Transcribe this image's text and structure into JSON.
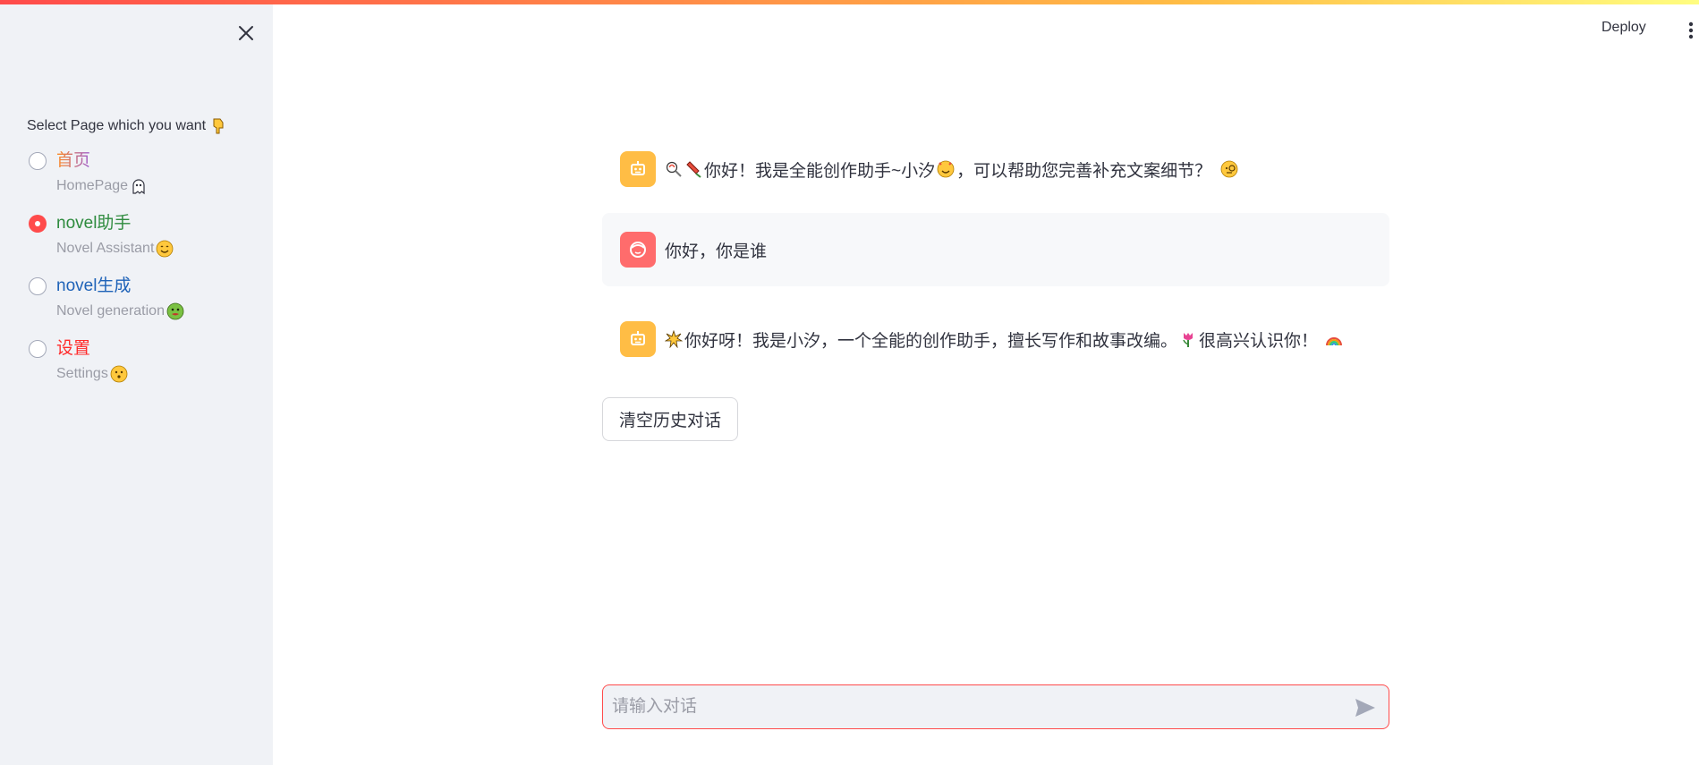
{
  "header": {
    "deploy_label": "Deploy",
    "menu_icon": "vertical-dots-icon"
  },
  "sidebar": {
    "close_icon": "close-icon",
    "prompt": "Select Page which you want",
    "prompt_icon": "pointing-down-hand-icon",
    "selected_index": 1,
    "options": [
      {
        "title": "首页",
        "subtitle": "HomePage",
        "icon": "ghost-icon",
        "title_color": "gradient-orange-purple"
      },
      {
        "title": "novel助手",
        "subtitle": "Novel Assistant",
        "icon": "smiling-face-icon",
        "title_color": "#2e8b3e"
      },
      {
        "title": "novel生成",
        "subtitle": "Novel generation",
        "icon": "nauseated-face-icon",
        "title_color": "#1f63b8"
      },
      {
        "title": "设置",
        "subtitle": "Settings",
        "icon": "neutral-face-icon",
        "title_color": "#ff2b2b"
      }
    ]
  },
  "chat": {
    "messages": [
      {
        "role": "assistant",
        "avatar_icon": "robot-icon",
        "text_a": "你好！我是全能创作助手~小汐",
        "text_b": "，可以帮助您完善补充文案细节？",
        "icons": [
          "lollipop-icon",
          "firecracker-icon",
          "smiling-hearts-icon",
          "monocle-face-icon"
        ]
      },
      {
        "role": "user",
        "avatar_icon": "face-icon",
        "text": "你好，你是谁"
      },
      {
        "role": "assistant",
        "avatar_icon": "robot-icon",
        "text_a": "你好呀！我是小汐，一个全能的创作助手，擅长写作和故事改编。",
        "text_b": "很高兴认识你！",
        "icons": [
          "sparkle-burst-icon",
          "tulip-icon",
          "rainbow-icon"
        ]
      }
    ],
    "clear_button_label": "清空历史对话",
    "input_placeholder": "请输入对话",
    "input_value": "",
    "send_icon": "send-icon"
  },
  "colors": {
    "accent": "#ff4b4b",
    "sidebar_bg": "#f0f2f6",
    "bot_avatar": "#ffbd45",
    "user_avatar": "#ff6c6c"
  }
}
